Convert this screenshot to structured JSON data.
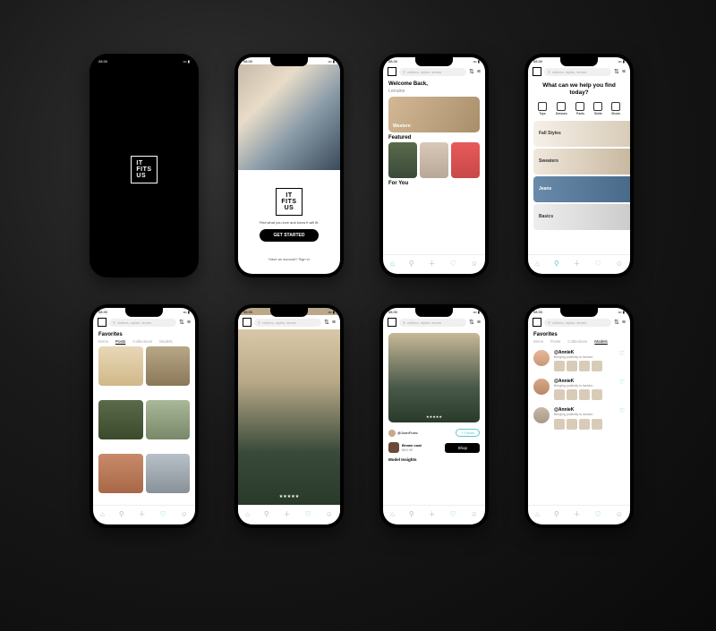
{
  "status_time": "08:30",
  "brand": {
    "line1": "IT",
    "line2": "FITS",
    "line3": "US"
  },
  "onboarding": {
    "tagline": "Find what you love and know it will fit.",
    "cta": "GET STARTED",
    "signin": "Have an account? Sign in"
  },
  "search_placeholder": "clothes, styles, stores",
  "home": {
    "welcome": "Welcome Back,",
    "name": "Lorraine",
    "hero_label": "Western",
    "featured": "Featured",
    "foryou": "For You"
  },
  "discover": {
    "title": "What can we help you find today?",
    "cats": [
      "Tops",
      "Dresses",
      "Pants",
      "Skirts",
      "Shoes"
    ],
    "strips": [
      "Fall Styles",
      "Sweaters",
      "Jeans",
      "Basics"
    ]
  },
  "favorites": {
    "title": "Favorites",
    "tabs": [
      "Items",
      "Posts",
      "Collections",
      "Models"
    ]
  },
  "product": {
    "user": "@JoanFranc",
    "follow": "+ Follow",
    "name": "Brown coat",
    "price": "$49.99",
    "shop": "Shop",
    "insights": "Model Insights"
  },
  "models": [
    {
      "handle": "@AnnieK",
      "bio": "Bringing positivity to fashion"
    },
    {
      "handle": "@AnnieK",
      "bio": "Bringing positivity to fashion"
    },
    {
      "handle": "@AnnieK",
      "bio": "Bringing positivity to fashion"
    }
  ],
  "nav": {
    "home": "⌂",
    "search": "⚲",
    "add": "＋",
    "heart": "♡",
    "user": "☺"
  }
}
